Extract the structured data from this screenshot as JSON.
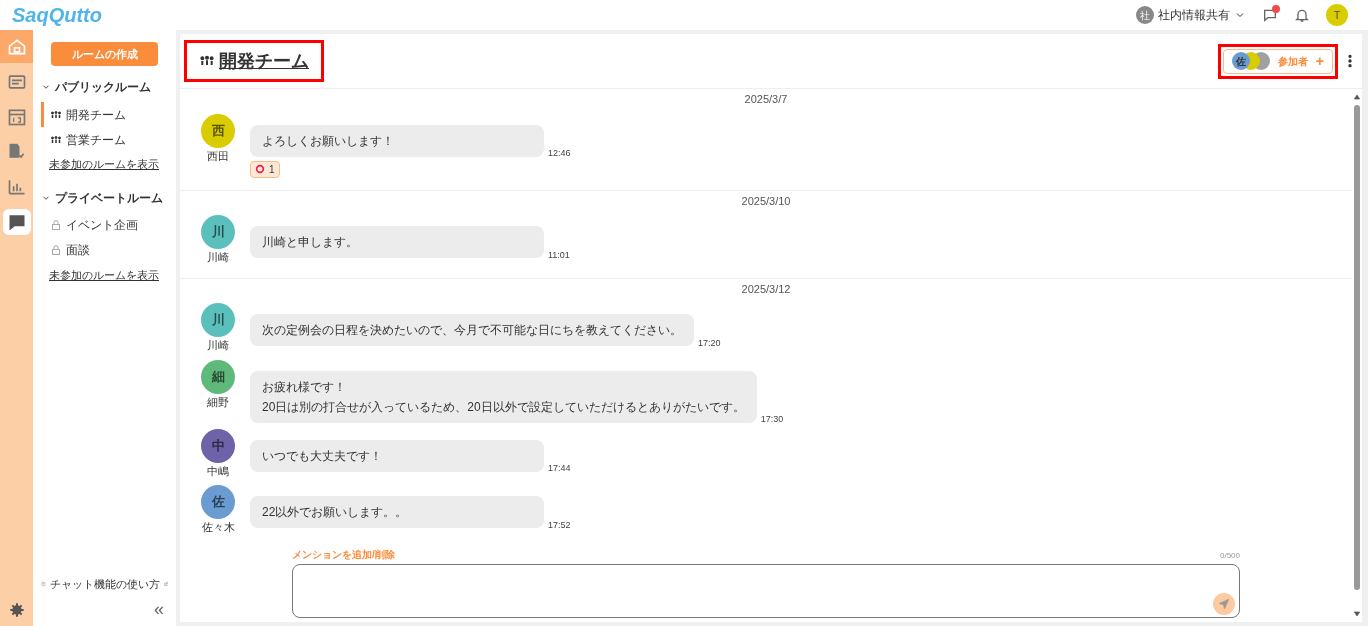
{
  "header": {
    "logo": "SaqQutto",
    "workspace": {
      "avatar": "社",
      "name": "社内情報共有"
    },
    "notification_dot": true,
    "user_avatar": "T"
  },
  "nav_rail": [
    {
      "selected": false
    },
    {
      "selected": false
    },
    {
      "selected": false
    },
    {
      "selected": false
    },
    {
      "selected": false
    },
    {
      "selected": true
    }
  ],
  "sidebar": {
    "create_button": "ルームの作成",
    "sections": [
      {
        "title": "パブリックルーム",
        "expanded": true,
        "rooms": [
          {
            "kind": "group",
            "name": "開発チーム",
            "selected": true
          },
          {
            "kind": "group",
            "name": "営業チーム",
            "selected": false
          }
        ],
        "more_link": "未参加のルームを表示"
      },
      {
        "title": "プライベートルーム",
        "expanded": true,
        "rooms": [
          {
            "kind": "lock",
            "name": "イベント企画",
            "selected": false
          },
          {
            "kind": "lock",
            "name": "面談",
            "selected": false
          }
        ],
        "more_link": "未参加のルームを表示"
      }
    ],
    "help_link": "チャット機能の使い方",
    "collapse": "«"
  },
  "room": {
    "title": "開発チーム",
    "participants": {
      "avatars": [
        {
          "text": "佐",
          "color": "#6a9bd1"
        },
        {
          "color": "#d9cc00"
        },
        {
          "color": "#a0a0a0"
        }
      ],
      "label": "参加者",
      "add": "+"
    }
  },
  "timeline": [
    {
      "kind": "date",
      "text": "2025/3/7"
    },
    {
      "kind": "message",
      "initial": "西",
      "name": "西田",
      "color": "#d9cc00",
      "lines": [
        "よろしくお願いします！"
      ],
      "time": "12:46",
      "reaction": {
        "count": "1"
      }
    },
    {
      "kind": "date",
      "text": "2025/3/10"
    },
    {
      "kind": "message",
      "initial": "川",
      "name": "川崎",
      "color": "#5bbfbb",
      "lines": [
        "川崎と申します。"
      ],
      "time": "11:01"
    },
    {
      "kind": "date",
      "text": "2025/3/12"
    },
    {
      "kind": "message",
      "initial": "川",
      "name": "川崎",
      "color": "#5bbfbb",
      "lines": [
        "次の定例会の日程を決めたいので、今月で不可能な日にちを教えてください。"
      ],
      "time": "17:20"
    },
    {
      "kind": "message",
      "initial": "細",
      "name": "細野",
      "color": "#5fb97a",
      "lines": [
        "お疲れ様です！",
        "20日は別の打合せが入っているため、20日以外で設定していただけるとありがたいです。"
      ],
      "time": "17:30"
    },
    {
      "kind": "message",
      "initial": "中",
      "name": "中嶋",
      "color": "#6e62a8",
      "lines": [
        "いつでも大丈夫です！"
      ],
      "time": "17:44"
    },
    {
      "kind": "message",
      "initial": "佐",
      "name": "佐々木",
      "color": "#6a9bd1",
      "lines": [
        "22以外でお願いします。。"
      ],
      "time": "17:52"
    }
  ],
  "composer": {
    "mention_link": "メンションを追加/削除",
    "counter": "0/500"
  }
}
